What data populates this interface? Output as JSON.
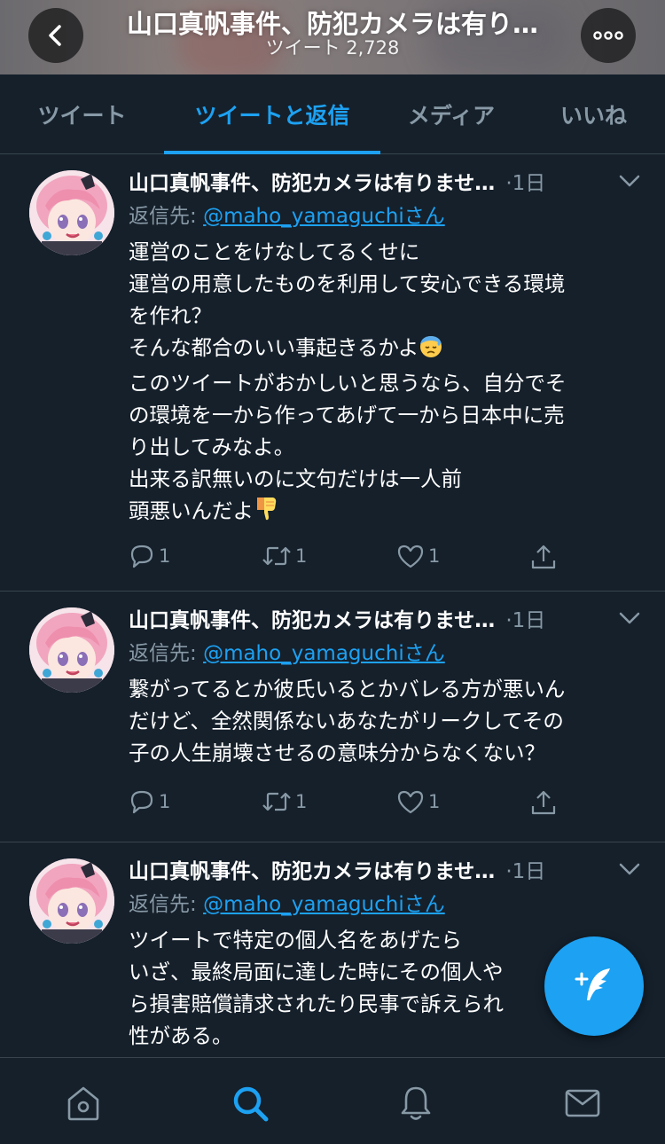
{
  "header": {
    "title": "山口真帆事件、防犯カメラは有り…",
    "subtitle": "ツイート 2,728"
  },
  "tabs": [
    {
      "label": "ツイート",
      "active": false
    },
    {
      "label": "ツイートと返信",
      "active": true
    },
    {
      "label": "メディア",
      "active": false
    },
    {
      "label": "いいね",
      "active": false
    }
  ],
  "tweets": [
    {
      "name": "山口真帆事件、防犯カメラは有りませ…",
      "time": "·1日",
      "reply_prefix": "返信先: ",
      "reply_handle": "@maho_yamaguchiさん",
      "lines": [
        "運営のことをけなしてるくせに",
        "運営の用意したものを利用して安心できる環境",
        "を作れ？",
        "そんな都合のいい事起きるかよ",
        "このツイートがおかしいと思うなら、自分でそ",
        "の環境を一から作ってあげて一から日本中に売",
        "り出してみなよ。",
        "出来る訳無いのに文句だけは一人前",
        "頭悪いんだよ"
      ],
      "reply_count": "1",
      "retweet_count": "1",
      "like_count": "1"
    },
    {
      "name": "山口真帆事件、防犯カメラは有りませ…",
      "time": "·1日",
      "reply_prefix": "返信先: ",
      "reply_handle": "@maho_yamaguchiさん",
      "lines": [
        "繋がってるとか彼氏いるとかバレる方が悪いん",
        "だけど、全然関係ないあなたがリークしてその",
        "子の人生崩壊させるの意味分からなくない？"
      ],
      "reply_count": "1",
      "retweet_count": "1",
      "like_count": "1"
    },
    {
      "name": "山口真帆事件、防犯カメラは有りませ…",
      "time": "·1日",
      "reply_prefix": "返信先: ",
      "reply_handle": "@maho_yamaguchiさん",
      "lines": [
        "ツイートで特定の個人名をあげたら",
        "いざ、最終局面に達した時にその個人や",
        "ら損害賠償請求されたり民事で訴えられ",
        "性がある。"
      ]
    }
  ],
  "colors": {
    "background": "#15202b",
    "accent": "#1da1f2",
    "muted": "#8899a6",
    "divider": "#38444d"
  },
  "icons": {
    "emoji_sweat": "downcast-face-with-sweat-emoji",
    "emoji_thumbs_down": "thumbs-down-emoji"
  }
}
